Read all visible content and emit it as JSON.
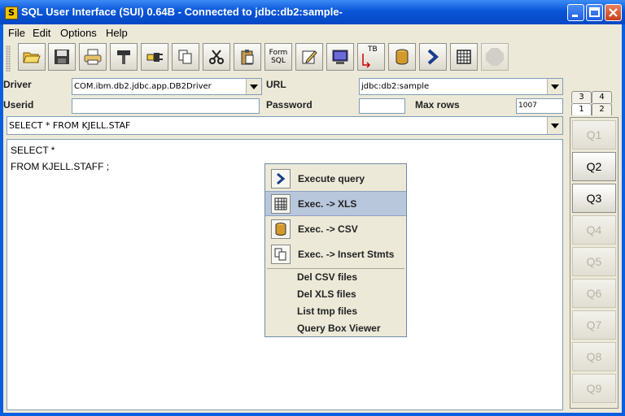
{
  "window": {
    "title": "SQL User Interface (SUI) 0.64B -  Connected to jdbc:db2:sample-",
    "app_icon": "S"
  },
  "menu": [
    "File",
    "Edit",
    "Options",
    "Help"
  ],
  "toolbar": {
    "form_sql_label_1": "Form",
    "form_sql_label_2": "SQL",
    "tb_label": "TB"
  },
  "connection": {
    "driver_label": "Driver",
    "driver_value": "COM.ibm.db2.jdbc.app.DB2Driver",
    "url_label": "URL",
    "url_value": "jdbc:db2:sample",
    "userid_label": "Userid",
    "userid_value": "",
    "password_label": "Password",
    "password_value": "",
    "maxrows_label": "Max rows",
    "maxrows_value": "1007"
  },
  "history_combo": "SELECT * FROM KJELL.STAF",
  "editor": {
    "line1": "SELECT *",
    "line2": "FROM KJELL.STAFF ;"
  },
  "context_menu": {
    "execute_query": "Execute query",
    "exec_xls": "Exec. -> XLS",
    "exec_csv": "Exec. -> CSV",
    "exec_insert": "Exec. -> Insert Stmts",
    "del_csv": "Del CSV files",
    "del_xls": "Del XLS files",
    "list_tmp": "List tmp files",
    "query_box_viewer": "Query Box Viewer"
  },
  "side_tabs": {
    "t1": "1",
    "t2": "2",
    "t3": "3",
    "t4": "4"
  },
  "query_buttons": [
    {
      "label": "Q1",
      "enabled": false
    },
    {
      "label": "Q2",
      "enabled": true
    },
    {
      "label": "Q3",
      "enabled": true
    },
    {
      "label": "Q4",
      "enabled": false
    },
    {
      "label": "Q5",
      "enabled": false
    },
    {
      "label": "Q6",
      "enabled": false
    },
    {
      "label": "Q7",
      "enabled": false
    },
    {
      "label": "Q8",
      "enabled": false
    },
    {
      "label": "Q9",
      "enabled": false
    }
  ],
  "colors": {
    "titlebar": "#0a55d8",
    "frame": "#ece9d8",
    "menu_highlight": "#b9c7dc"
  }
}
